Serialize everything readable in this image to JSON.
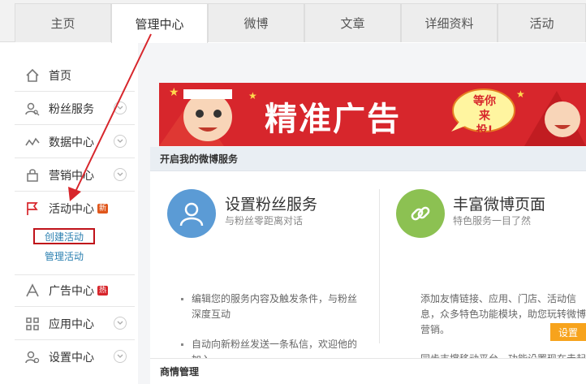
{
  "tabs": [
    {
      "label": "主页"
    },
    {
      "label": "管理中心"
    },
    {
      "label": "微博"
    },
    {
      "label": "文章"
    },
    {
      "label": "详细资料"
    },
    {
      "label": "活动"
    }
  ],
  "sidebar": {
    "items": [
      {
        "label": "首页",
        "icon": "home-icon"
      },
      {
        "label": "粉丝服务",
        "icon": "user-search-icon"
      },
      {
        "label": "数据中心",
        "icon": "line-chart-icon"
      },
      {
        "label": "营销中心",
        "icon": "shopping-bag-icon"
      },
      {
        "label": "活动中心",
        "icon": "flag-icon",
        "badge": "新"
      },
      {
        "label": "广告中心",
        "icon": "ad-icon",
        "badge": "热"
      },
      {
        "label": "应用中心",
        "icon": "grid-icon"
      },
      {
        "label": "设置中心",
        "icon": "user-settings-icon"
      }
    ],
    "sub_items": [
      "创建活动",
      "管理活动"
    ]
  },
  "banner": {
    "text": "精准广告",
    "bubble_line1": "等你",
    "bubble_line2": "来投!"
  },
  "service_section": {
    "title": "开启我的微博服务"
  },
  "services": [
    {
      "title": "设置粉丝服务",
      "subtitle": "与粉丝零距离对话",
      "bullets": [
        "编辑您的服务内容及触发条件，与粉丝深度互动",
        "自动向新粉丝发送一条私信，欢迎他的加入"
      ]
    },
    {
      "title": "丰富微博页面",
      "subtitle": "特色服务一目了然",
      "bullets": [
        "添加友情链接、应用、门店、活动信息，众多特色功能模块，助您玩转微博营销。",
        "同步支撑移动平台，功能设置现在走起"
      ]
    }
  ],
  "set_button": "设置",
  "biz_section": {
    "title": "商情管理"
  },
  "colors": {
    "brand_red": "#d7262c",
    "accent_orange": "#f7a31c",
    "link_blue": "#2a7fb0",
    "highlight_red": "#c0121a"
  }
}
